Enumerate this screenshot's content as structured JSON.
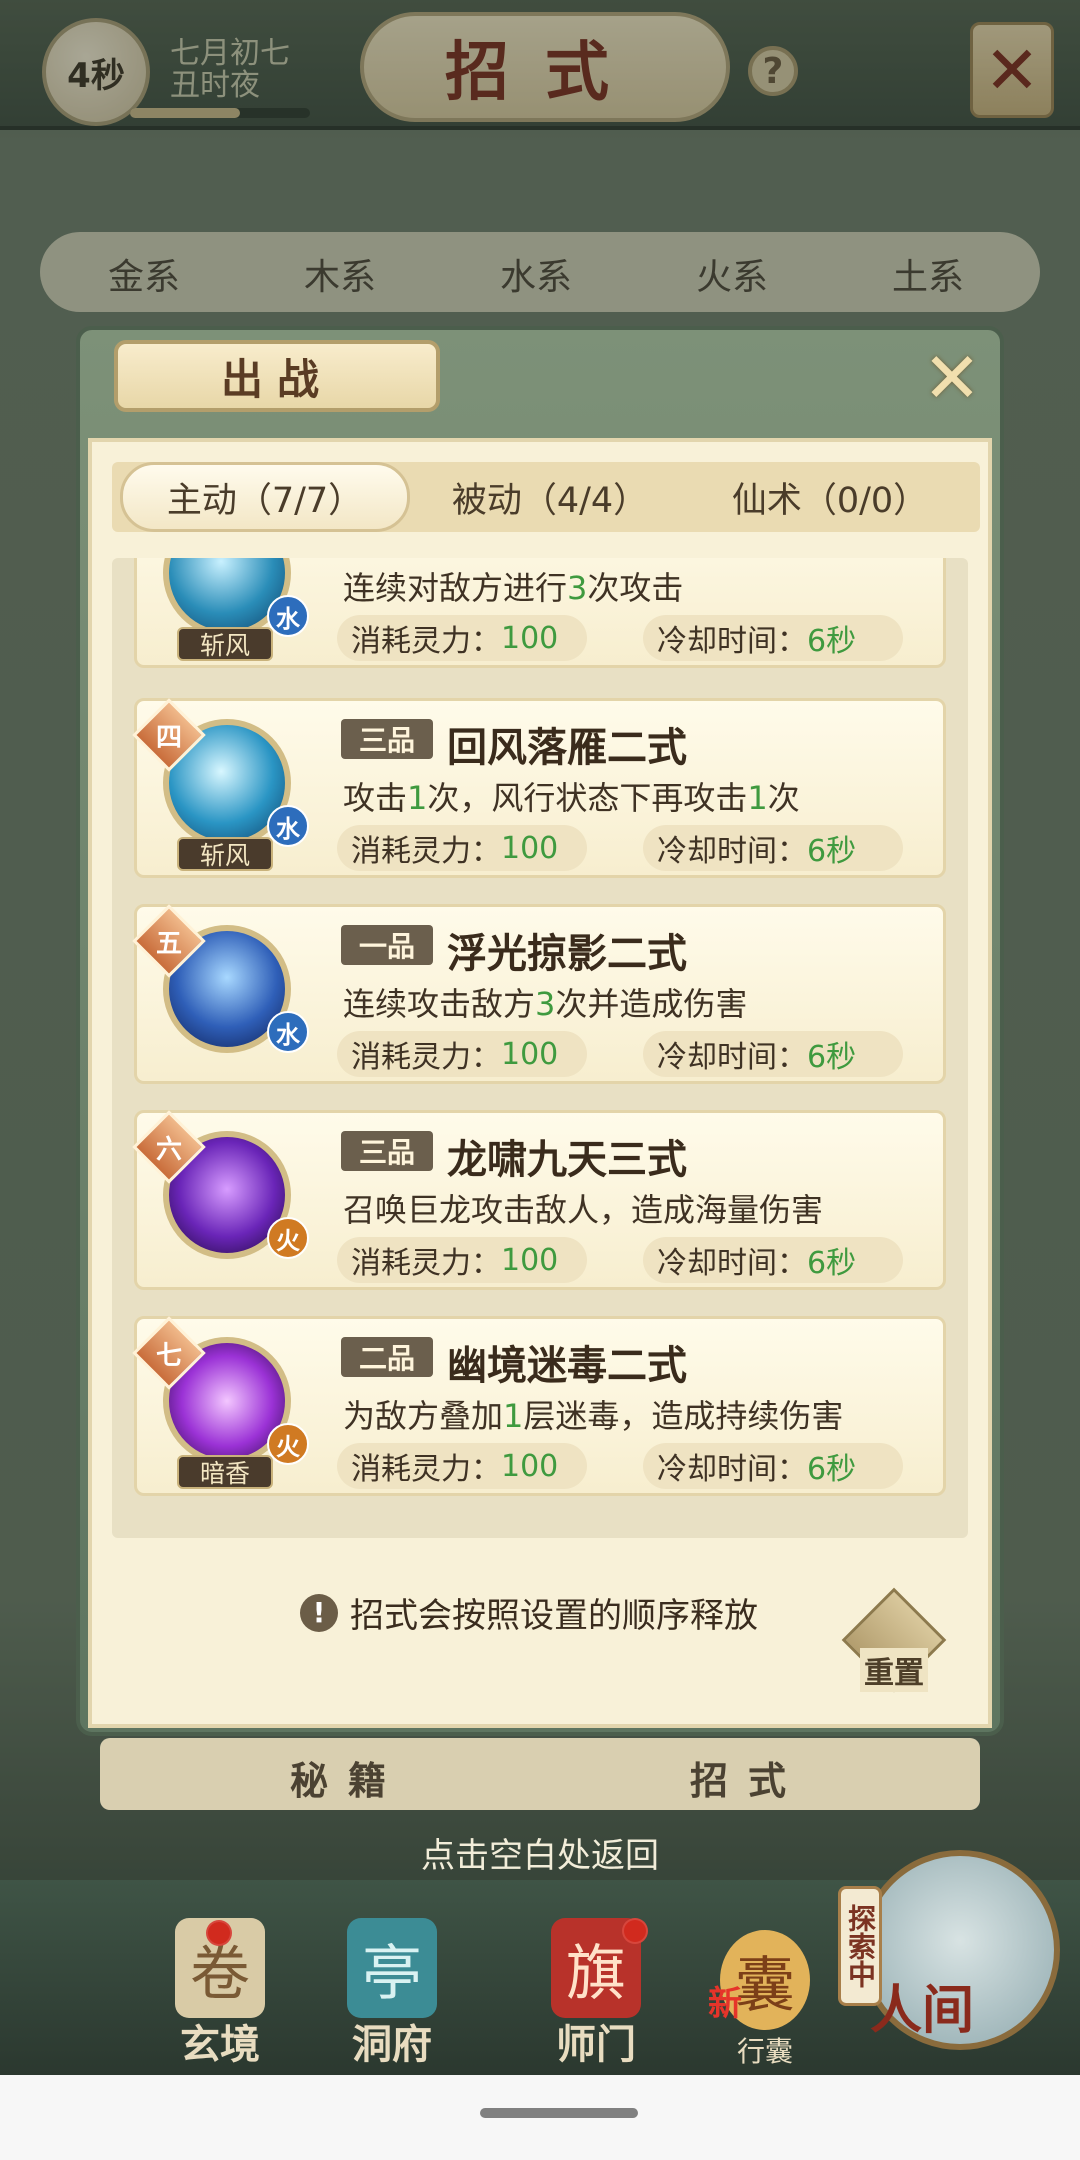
{
  "status": {
    "timer": "4秒",
    "date_line1": "七月初七",
    "date_line2": "丑时夜"
  },
  "header": {
    "title": "招式",
    "help_label": "?"
  },
  "element_tabs": [
    "金系",
    "木系",
    "水系",
    "火系",
    "土系"
  ],
  "modal": {
    "title": "出战",
    "subtabs": [
      {
        "label": "主动（7/7）"
      },
      {
        "label": "被动（4/4）"
      },
      {
        "label": "仙术（0/0）"
      }
    ],
    "stat_cost_label": "消耗灵力：",
    "stat_cd_label": "冷却时间：",
    "skills": [
      {
        "order": "",
        "grade": "",
        "name": "",
        "desc_pre": "连续对敌方进行",
        "desc_num": "3",
        "desc_post": "次攻击",
        "cost": "100",
        "cooldown": "6秒",
        "tag": "斩风",
        "element": "水"
      },
      {
        "order": "四",
        "grade": "三品",
        "name": "回风落雁二式",
        "desc_pre": "攻击",
        "desc_num": "1",
        "desc_post": "次，风行状态下再攻击",
        "desc_num2": "1",
        "desc_post2": "次",
        "cost": "100",
        "cooldown": "6秒",
        "tag": "斩风",
        "element": "水"
      },
      {
        "order": "五",
        "grade": "一品",
        "name": "浮光掠影二式",
        "desc_pre": "连续攻击敌方",
        "desc_num": "3",
        "desc_post": "次并造成伤害",
        "cost": "100",
        "cooldown": "6秒",
        "tag": "",
        "element": "水"
      },
      {
        "order": "六",
        "grade": "三品",
        "name": "龙啸九天三式",
        "desc_pre": "召唤巨龙攻击敌人，造成海量伤害",
        "desc_num": "",
        "desc_post": "",
        "cost": "100",
        "cooldown": "6秒",
        "tag": "",
        "element": "火"
      },
      {
        "order": "七",
        "grade": "二品",
        "name": "幽境迷毒二式",
        "desc_pre": "为敌方叠加",
        "desc_num": "1",
        "desc_post": "层迷毒，造成持续伤害",
        "cost": "100",
        "cooldown": "6秒",
        "tag": "暗香",
        "element": "火"
      }
    ],
    "tip": "招式会按照设置的顺序释放",
    "tip_icon": "!",
    "reset_label": "重置"
  },
  "lower_tabs": [
    "秘籍",
    "招式"
  ],
  "return_hint": "点击空白处返回",
  "bottom_nav": [
    {
      "label": "玄境",
      "icon": "scroll-icon",
      "badge": true
    },
    {
      "label": "洞府",
      "icon": "pavilion-icon",
      "badge": false
    },
    {
      "label": "师门",
      "icon": "banner-icon",
      "badge": true
    },
    {
      "label": "行囊",
      "icon": "bag-icon",
      "badge": false,
      "new_label": "新"
    },
    {
      "label": "人间",
      "icon": "world-icon",
      "badge": false
    }
  ],
  "explore_tag": "探索中",
  "colors": {
    "accent_green": "#3f9a3f",
    "water": "#2d6dbc",
    "fire": "#d07a22",
    "title_red": "#7a2d1f"
  }
}
